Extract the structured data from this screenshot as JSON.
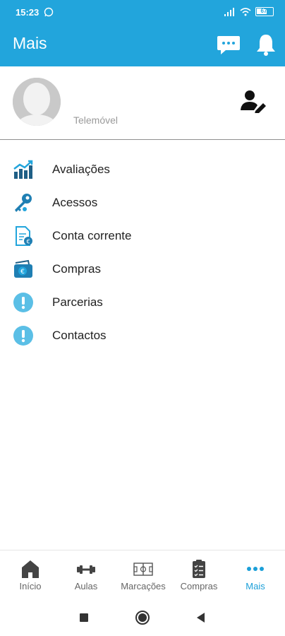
{
  "status": {
    "time": "15:23",
    "battery": "67"
  },
  "header": {
    "title": "Mais"
  },
  "profile": {
    "phone_label": "Telemóvel"
  },
  "menu": {
    "items": [
      {
        "label": "Avaliações",
        "icon": "chart-icon"
      },
      {
        "label": "Acessos",
        "icon": "key-icon"
      },
      {
        "label": "Conta corrente",
        "icon": "document-euro-icon"
      },
      {
        "label": "Compras",
        "icon": "wallet-euro-icon"
      },
      {
        "label": "Parcerias",
        "icon": "exclamation-icon"
      },
      {
        "label": "Contactos",
        "icon": "exclamation-icon"
      }
    ]
  },
  "bottom_nav": {
    "items": [
      {
        "label": "Início",
        "icon": "home-icon"
      },
      {
        "label": "Aulas",
        "icon": "dumbbell-icon"
      },
      {
        "label": "Marcações",
        "icon": "court-icon"
      },
      {
        "label": "Compras",
        "icon": "clipboard-icon"
      },
      {
        "label": "Mais",
        "icon": "more-dots-icon",
        "active": true
      }
    ]
  },
  "colors": {
    "primary": "#22a5dc",
    "accent": "#1b9fd8",
    "icon_dark": "#1f5f86"
  }
}
